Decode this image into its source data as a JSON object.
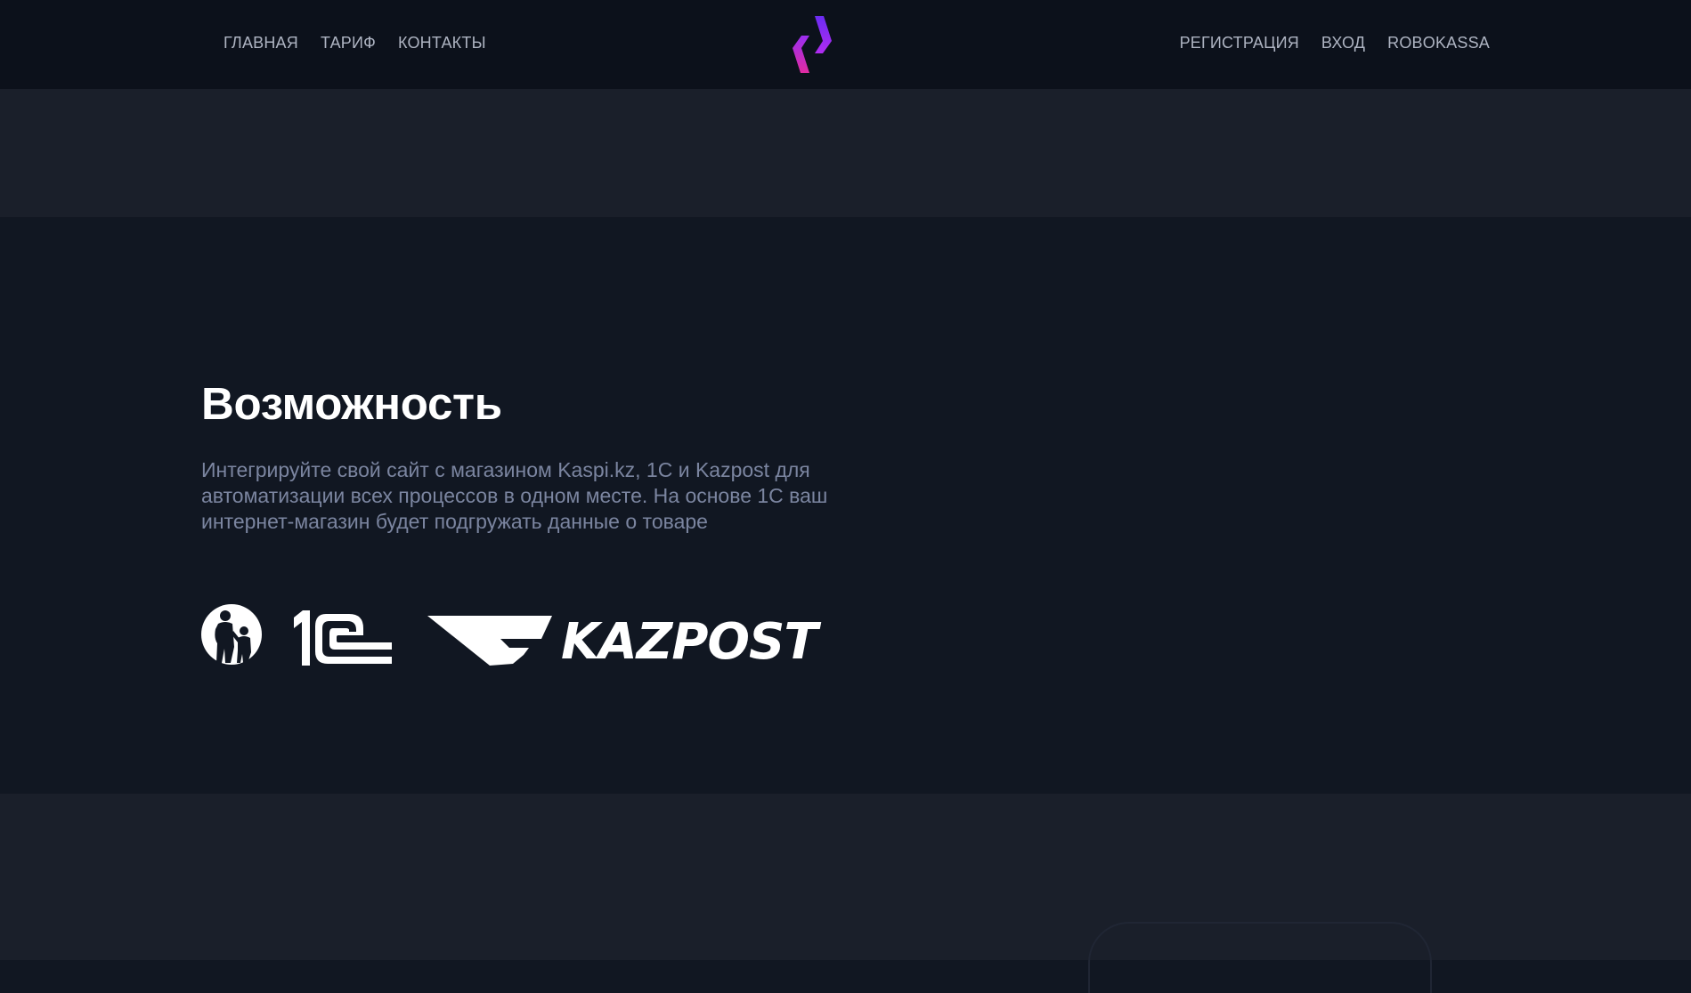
{
  "header": {
    "nav_left": [
      {
        "label": "ГЛАВНАЯ"
      },
      {
        "label": "ТАРИФ"
      },
      {
        "label": "КОНТАКТЫ"
      }
    ],
    "nav_right": [
      {
        "label": "РЕГИСТРАЦИЯ"
      },
      {
        "label": "ВХОД"
      },
      {
        "label": "ROBOKASSA"
      }
    ],
    "logo_icon": "chevron-brackets-logo-icon"
  },
  "feature": {
    "title": "Возможность",
    "description": "Интегрируйте свой сайт с магазином Kaspi.kz, 1С и Kazpost для автоматизации всех процессов в одном месте. На основе 1С ваш интернет-магазин будет подгружать данные о товаре",
    "partners": [
      {
        "name": "Kaspi.kz",
        "icon": "kaspi-logo"
      },
      {
        "name": "1С",
        "icon": "1c-logo"
      },
      {
        "name": "KAZPOST",
        "icon": "kazpost-logo"
      }
    ]
  },
  "colors": {
    "header_bg": "#0c111b",
    "band_bg": "#1a1f2a",
    "section_bg": "#111722",
    "nav_text": "#aeb4c2",
    "desc_text": "#7b85a0",
    "accent_purple": "#9b2cf5",
    "accent_magenta": "#d42ca8"
  }
}
